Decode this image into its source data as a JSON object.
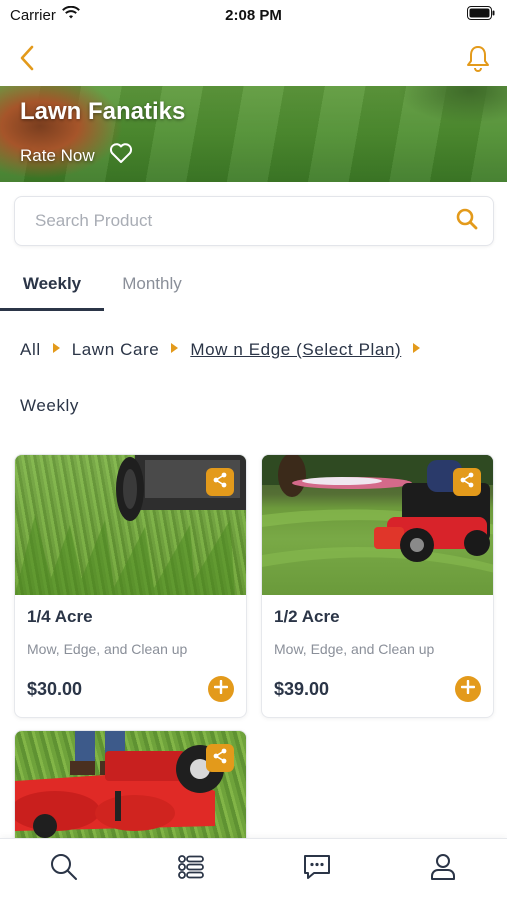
{
  "status_bar": {
    "carrier": "Carrier",
    "time": "2:08 PM"
  },
  "nav": {
    "back_icon": "chevron-left-icon",
    "notification_icon": "bell-icon"
  },
  "hero": {
    "title": "Lawn Fanatiks",
    "rate_label": "Rate Now",
    "favorite_icon": "heart-outline-icon"
  },
  "search": {
    "placeholder": "Search Product",
    "icon": "search-icon"
  },
  "tabs": [
    {
      "label": "Weekly",
      "active": true
    },
    {
      "label": "Monthly",
      "active": false
    }
  ],
  "breadcrumb": {
    "items": [
      "All",
      "Lawn Care",
      "Mow n Edge (Select Plan)"
    ],
    "subtitle": "Weekly"
  },
  "products": [
    {
      "title": "1/4 Acre",
      "description": "Mow, Edge, and Clean up",
      "price": "$30.00"
    },
    {
      "title": "1/2 Acre",
      "description": "Mow, Edge, and Clean up",
      "price": "$39.00"
    },
    {
      "title": "",
      "description": "",
      "price": ""
    }
  ],
  "bottom_nav": [
    {
      "icon": "search-icon"
    },
    {
      "icon": "list-icon"
    },
    {
      "icon": "chat-icon"
    },
    {
      "icon": "user-icon"
    }
  ],
  "colors": {
    "accent": "#e39a1b",
    "text_dark": "#2b3547",
    "text_muted": "#8a8f99"
  }
}
